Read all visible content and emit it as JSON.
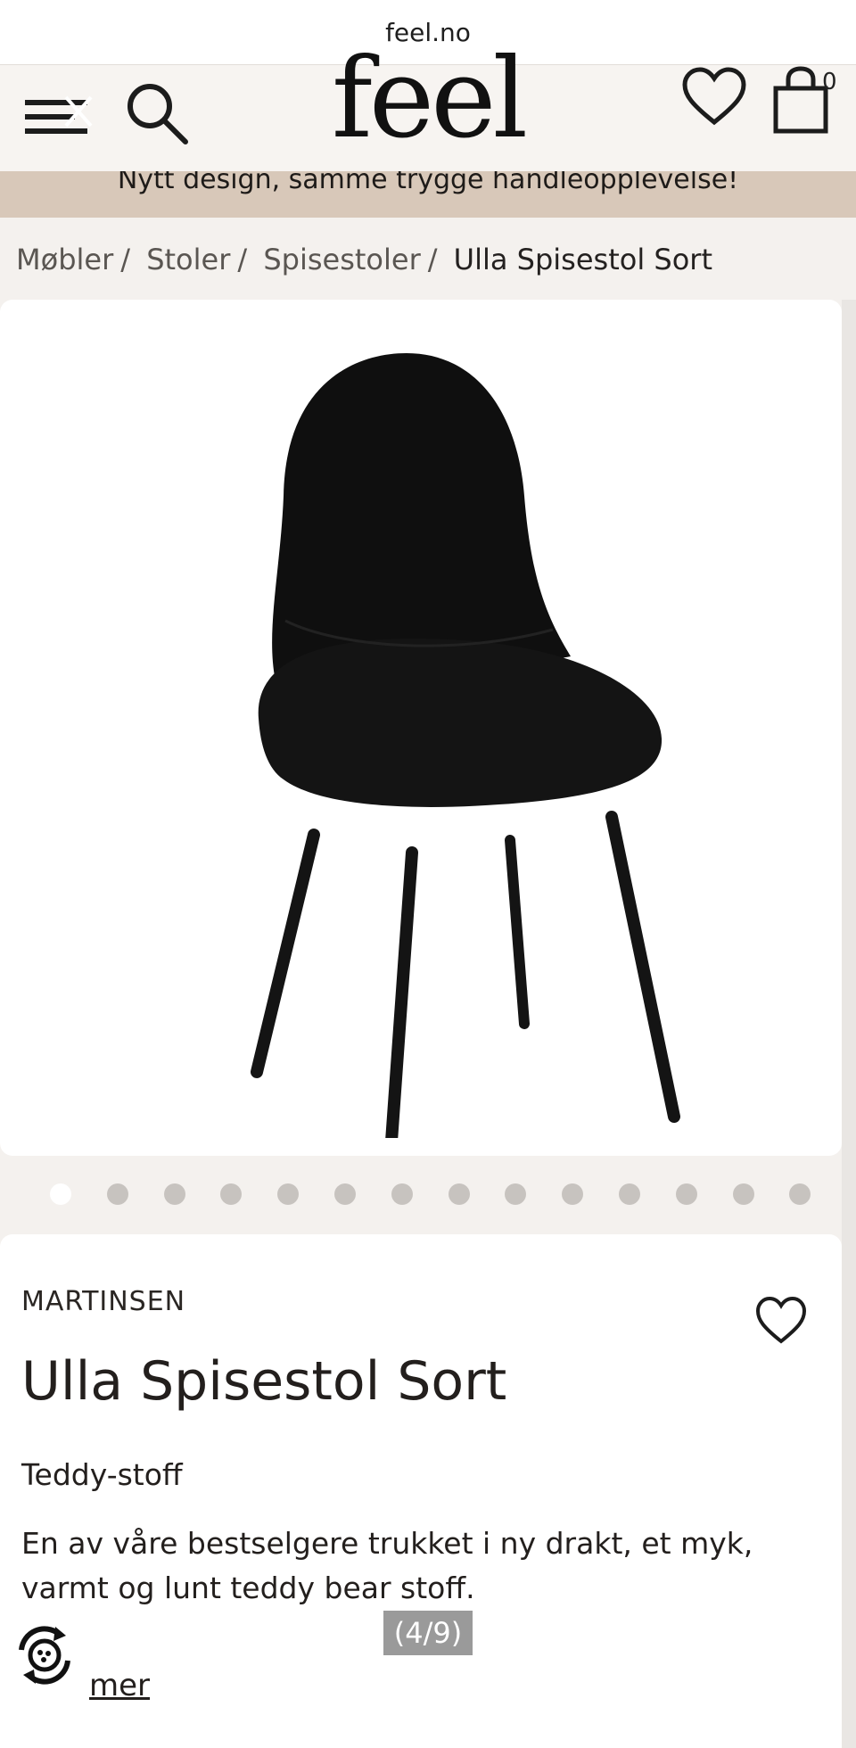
{
  "browser": {
    "url": "feel.no"
  },
  "header": {
    "logo": "feel",
    "cart_count": "0"
  },
  "banner": {
    "text": "Nytt design, samme trygge handleopplevelse!"
  },
  "breadcrumb": [
    {
      "label": "Møbler"
    },
    {
      "label": "Stoler"
    },
    {
      "label": "Spisestoler"
    },
    {
      "label": "Ulla Spisestol Sort"
    }
  ],
  "breadcrumb_separator": "/",
  "gallery": {
    "image_count": 14,
    "active_index": 0,
    "image_counter": "(4/9)"
  },
  "product": {
    "brand": "MARTINSEN",
    "title": "Ulla Spisestol Sort",
    "subtitle": "Teddy-stoff",
    "description": "En av våre bestselgere trukket i ny drakt, et myk, varmt og lunt teddy bear stoff.",
    "more_link": "mer"
  },
  "colors": {
    "banner_bg": "#d8c8b9",
    "page_bg": "#f4f1ee",
    "text": "#231f1d"
  }
}
